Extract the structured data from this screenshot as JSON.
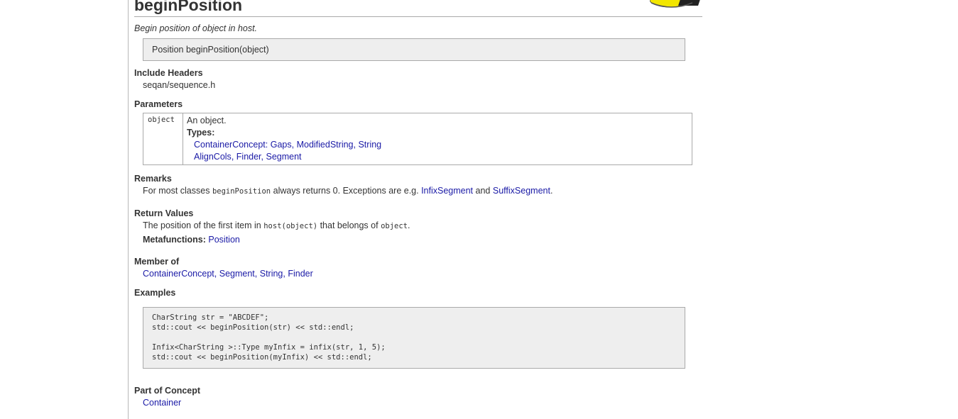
{
  "page": {
    "title": "beginPosition",
    "summary": "Begin position of object in host.",
    "signature": "Position beginPosition(object)"
  },
  "include_headers": {
    "heading": "Include Headers",
    "value": "seqan/sequence.h"
  },
  "parameters": {
    "heading": "Parameters",
    "name": "object",
    "description": "An object.",
    "types_label": "Types:",
    "types_line1": {
      "concept": "ContainerConcept",
      "sep": ":",
      "items": [
        "Gaps",
        "ModifiedString",
        "String"
      ]
    },
    "types_line2": {
      "items": [
        "AlignCols",
        "Finder",
        "Segment"
      ]
    }
  },
  "remarks": {
    "heading": "Remarks",
    "text_before": "For most classes",
    "code": "beginPosition",
    "text_middle": "always returns 0. Exceptions are e.g.",
    "link1": "InfixSegment",
    "and": "and",
    "link2": "SuffixSegment",
    "end": "."
  },
  "return_values": {
    "heading": "Return Values",
    "text_before": "The position of the first item in",
    "code1": "host(object)",
    "text_middle": "that belongs of",
    "code2": "object",
    "end": ".",
    "metafunctions_label": "Metafunctions:",
    "metafunction": "Position"
  },
  "member_of": {
    "heading": "Member of",
    "items": [
      "ContainerConcept",
      "Segment",
      "String",
      "Finder"
    ]
  },
  "examples": {
    "heading": "Examples",
    "code": "CharString str = \"ABCDEF\";\nstd::cout << beginPosition(str) << std::endl;\n\nInfix<CharString >::Type myInfix = infix(str, 1, 5);\nstd::cout << beginPosition(myInfix) << std::endl;"
  },
  "part_of_concept": {
    "heading": "Part of Concept",
    "item": "Container"
  },
  "colors": {
    "link": "#1a1aa6",
    "box_bg": "#eeeeee",
    "border": "#aaaaaa",
    "logo_yellow": "#f2e600"
  },
  "icons": {
    "logo": "seqan-logo"
  }
}
